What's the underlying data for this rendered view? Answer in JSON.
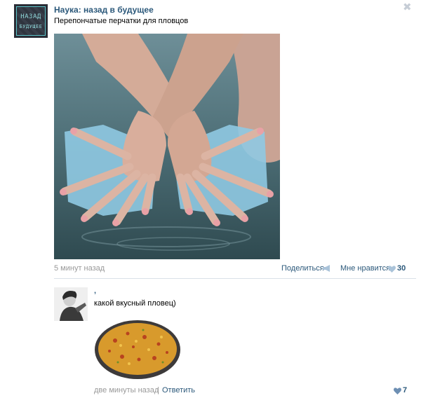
{
  "post": {
    "community_name": "Наука: назад в будущее",
    "avatar_logo_line1": "НАЗАД",
    "avatar_logo_line2": "БУДУЩЕЕ",
    "text": "Перепончатые перчатки для пловцов",
    "time": "5 минут назад",
    "share_label": "Поделиться",
    "like_label": "Мне нравится",
    "like_count": "30",
    "close_icon": "close-icon"
  },
  "comment": {
    "author": "‚",
    "text": "какой вкусный пловец)",
    "time": "две минуты назад",
    "separator": "|",
    "reply_label": "Ответить",
    "like_count": "7"
  },
  "colors": {
    "link": "#2b587a",
    "meta": "#999999",
    "icon": "#aac3d9",
    "divider": "#dae1e8"
  }
}
